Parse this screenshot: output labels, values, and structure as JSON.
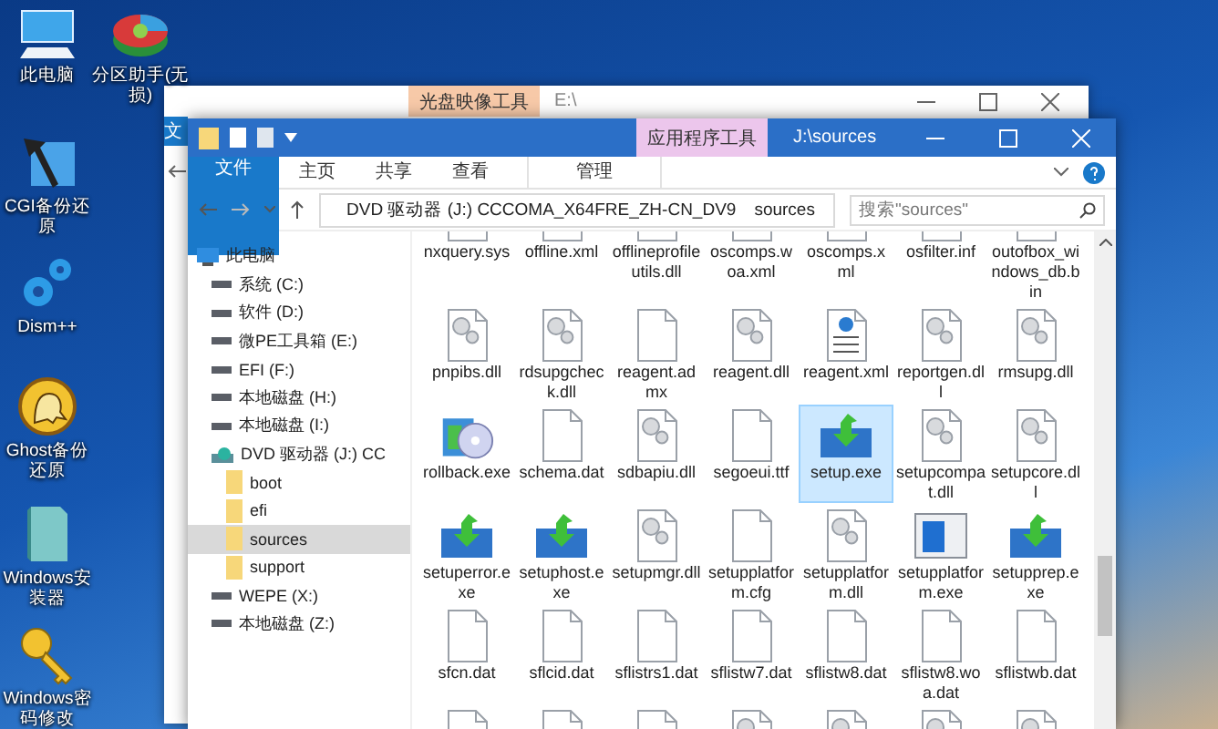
{
  "desktop_icons": [
    {
      "label": "此电脑",
      "kind": "computer"
    },
    {
      "label": "分区助手(无损)",
      "kind": "disk"
    },
    {
      "label": "CGI备份还原",
      "kind": "tool"
    },
    {
      "label": "Dism++",
      "kind": "gears"
    },
    {
      "label": "Ghost备份还原",
      "kind": "ghost"
    },
    {
      "label": "Windows安装器",
      "kind": "installer"
    },
    {
      "label": "Windows密码修改",
      "kind": "key"
    }
  ],
  "back_window": {
    "context_tab": "光盘映像工具",
    "title": "E:\\",
    "ribbon_tab": "文"
  },
  "window": {
    "context_tab": "应用程序工具",
    "title": "J:\\sources",
    "ribbon_tabs": [
      {
        "label": "文件",
        "kind": "file"
      },
      {
        "label": "主页",
        "kind": "tab"
      },
      {
        "label": "共享",
        "kind": "tab"
      },
      {
        "label": "查看",
        "kind": "tab"
      },
      {
        "label": "管理",
        "kind": "context"
      }
    ]
  },
  "address": {
    "path": [
      "DVD 驱动器 (J:) CCCOMA_X64FRE_ZH-CN_DV9",
      "sources"
    ]
  },
  "search": {
    "placeholder": "搜索\"sources\""
  },
  "sidebar": {
    "items": [
      {
        "label": "此电脑",
        "kind": "computer",
        "selected": false,
        "children": [
          {
            "label": "系统 (C:)",
            "kind": "drive",
            "selected": false
          },
          {
            "label": "软件 (D:)",
            "kind": "drive",
            "selected": false
          },
          {
            "label": "微PE工具箱 (E:)",
            "kind": "drive",
            "selected": false
          },
          {
            "label": "EFI (F:)",
            "kind": "drive",
            "selected": false
          },
          {
            "label": "本地磁盘 (H:)",
            "kind": "drive",
            "selected": false
          },
          {
            "label": "本地磁盘 (I:)",
            "kind": "drive",
            "selected": false
          },
          {
            "label": "DVD 驱动器 (J:) CC",
            "kind": "dvd",
            "selected": false,
            "children": [
              {
                "label": "boot",
                "kind": "folder",
                "selected": false
              },
              {
                "label": "efi",
                "kind": "folder",
                "selected": false
              },
              {
                "label": "sources",
                "kind": "folder",
                "selected": true
              },
              {
                "label": "support",
                "kind": "folder",
                "selected": false
              }
            ]
          },
          {
            "label": "WEPE (X:)",
            "kind": "drive",
            "selected": false
          },
          {
            "label": "本地磁盘 (Z:)",
            "kind": "drive",
            "selected": false
          }
        ]
      }
    ]
  },
  "files": [
    {
      "name": "nxquery.sys",
      "selected": false
    },
    {
      "name": "offline.xml",
      "selected": false
    },
    {
      "name": "offlineprofileutils.dll",
      "selected": false
    },
    {
      "name": "oscomps.woa.xml",
      "selected": false
    },
    {
      "name": "oscomps.xml",
      "selected": false
    },
    {
      "name": "osfilter.inf",
      "selected": false
    },
    {
      "name": "outofbox_windows_db.bin",
      "selected": false
    },
    {
      "name": "pnpibs.dll",
      "kind": "gear",
      "selected": false
    },
    {
      "name": "rdsupgcheck.dll",
      "kind": "gear",
      "selected": false
    },
    {
      "name": "reagent.admx",
      "kind": "blank",
      "selected": false
    },
    {
      "name": "reagent.dll",
      "kind": "gear",
      "selected": false
    },
    {
      "name": "reagent.xml",
      "kind": "web",
      "selected": false
    },
    {
      "name": "reportgen.dll",
      "kind": "gear",
      "selected": false
    },
    {
      "name": "rmsupg.dll",
      "kind": "gear",
      "selected": false
    },
    {
      "name": "rollback.exe",
      "kind": "package",
      "selected": false
    },
    {
      "name": "schema.dat",
      "kind": "blank",
      "selected": false
    },
    {
      "name": "sdbapiu.dll",
      "kind": "gear",
      "selected": false
    },
    {
      "name": "segoeui.ttf",
      "kind": "blank",
      "selected": false
    },
    {
      "name": "setup.exe",
      "kind": "setup",
      "selected": true
    },
    {
      "name": "setupcompat.dll",
      "kind": "gear",
      "selected": false
    },
    {
      "name": "setupcore.dll",
      "kind": "gear",
      "selected": false
    },
    {
      "name": "setuperror.exe",
      "kind": "setup",
      "selected": false
    },
    {
      "name": "setuphost.exe",
      "kind": "setup",
      "selected": false
    },
    {
      "name": "setupmgr.dll",
      "kind": "gear",
      "selected": false
    },
    {
      "name": "setupplatform.cfg",
      "kind": "blank",
      "selected": false
    },
    {
      "name": "setupplatform.dll",
      "kind": "gear",
      "selected": false
    },
    {
      "name": "setupplatform.exe",
      "kind": "window",
      "selected": false
    },
    {
      "name": "setupprep.exe",
      "kind": "setup",
      "selected": false
    },
    {
      "name": "sfcn.dat",
      "kind": "blank",
      "selected": false
    },
    {
      "name": "sflcid.dat",
      "kind": "blank",
      "selected": false
    },
    {
      "name": "sflistrs1.dat",
      "kind": "blank",
      "selected": false
    },
    {
      "name": "sflistw7.dat",
      "kind": "blank",
      "selected": false
    },
    {
      "name": "sflistw8.dat",
      "kind": "blank",
      "selected": false
    },
    {
      "name": "sflistw8.woa.dat",
      "kind": "blank",
      "selected": false
    },
    {
      "name": "sflistwb.dat",
      "kind": "blank",
      "selected": false
    }
  ],
  "files_cut_off": [
    {
      "kind": "blank"
    },
    {
      "kind": "blank"
    },
    {
      "kind": "blank"
    },
    {
      "kind": "gear"
    },
    {
      "kind": "gear"
    },
    {
      "kind": "gear"
    },
    {
      "kind": "gear"
    }
  ]
}
